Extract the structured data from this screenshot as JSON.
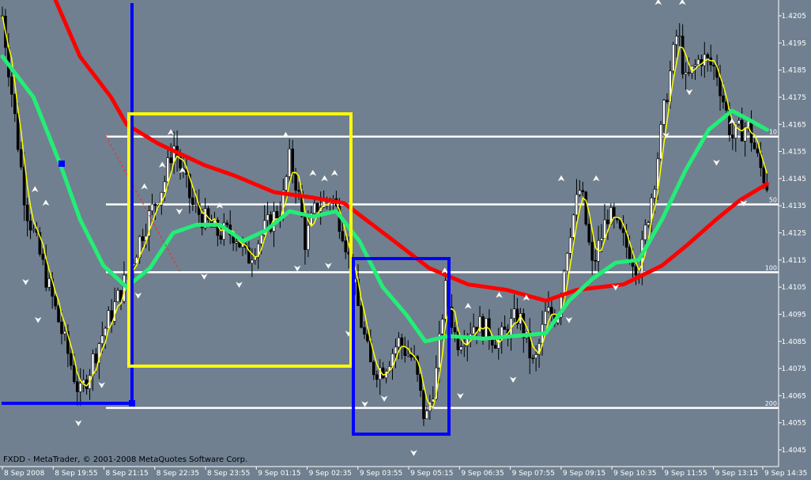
{
  "chart_data": {
    "type": "candlestick",
    "copyright": "FXDD - MetaTrader, © 2001-2008 MetaQuotes Software Corp.",
    "ylim": [
      1.40395,
      1.42125
    ],
    "y_ticks": [
      "1.4205",
      "1.4195",
      "1.4185",
      "1.4175",
      "1.4165",
      "1.4155",
      "1.4145",
      "1.4135",
      "1.4125",
      "1.4115",
      "1.4105",
      "1.4095",
      "1.4085",
      "1.4075",
      "1.4065",
      "1.4055",
      "1.4045"
    ],
    "x_ticks": [
      "8 Sep 2008",
      "8 Sep 19:55",
      "8 Sep 21:15",
      "8 Sep 22:35",
      "8 Sep 23:55",
      "9 Sep 01:15",
      "9 Sep 02:35",
      "9 Sep 03:55",
      "9 Sep 05:15",
      "9 Sep 06:35",
      "9 Sep 07:55",
      "9 Sep 09:15",
      "9 Sep 10:35",
      "9 Sep 11:55",
      "9 Sep 13:15",
      "9 Sep 14:35"
    ],
    "x_tick_fraction": [
      0.0,
      0.0668,
      0.1336,
      0.2004,
      0.2672,
      0.334,
      0.4008,
      0.4676,
      0.5344,
      0.6012,
      0.668,
      0.7348,
      0.8016,
      0.8684,
      0.9352,
      1.0
    ],
    "fib_levels": [
      {
        "label": "10",
        "price": 1.41605
      },
      {
        "label": "50",
        "price": 1.41355
      },
      {
        "label": "100",
        "price": 1.41105
      },
      {
        "label": "200",
        "price": 1.40605
      }
    ],
    "price_path": [
      [
        0.0,
        1.4205
      ],
      [
        0.03,
        1.4135
      ],
      [
        0.06,
        1.4105
      ],
      [
        0.08,
        1.4085
      ],
      [
        0.1,
        1.4065
      ],
      [
        0.125,
        1.4085
      ],
      [
        0.155,
        1.4105
      ],
      [
        0.18,
        1.4125
      ],
      [
        0.21,
        1.4145
      ],
      [
        0.22,
        1.4158
      ],
      [
        0.245,
        1.4135
      ],
      [
        0.275,
        1.4125
      ],
      [
        0.3,
        1.4125
      ],
      [
        0.315,
        1.4115
      ],
      [
        0.335,
        1.4125
      ],
      [
        0.36,
        1.4135
      ],
      [
        0.37,
        1.4152
      ],
      [
        0.38,
        1.4142
      ],
      [
        0.39,
        1.4122
      ],
      [
        0.405,
        1.4135
      ],
      [
        0.425,
        1.4138
      ],
      [
        0.44,
        1.4125
      ],
      [
        0.46,
        1.4095
      ],
      [
        0.475,
        1.4075
      ],
      [
        0.49,
        1.4075
      ],
      [
        0.51,
        1.4085
      ],
      [
        0.53,
        1.4078
      ],
      [
        0.545,
        1.4055
      ],
      [
        0.56,
        1.4075
      ],
      [
        0.57,
        1.4105
      ],
      [
        0.585,
        1.4085
      ],
      [
        0.61,
        1.4092
      ],
      [
        0.64,
        1.4085
      ],
      [
        0.665,
        1.4095
      ],
      [
        0.685,
        1.4075
      ],
      [
        0.7,
        1.4095
      ],
      [
        0.715,
        1.4095
      ],
      [
        0.73,
        1.4125
      ],
      [
        0.745,
        1.4142
      ],
      [
        0.76,
        1.4112
      ],
      [
        0.78,
        1.4132
      ],
      [
        0.8,
        1.4122
      ],
      [
        0.82,
        1.4112
      ],
      [
        0.84,
        1.4145
      ],
      [
        0.855,
        1.4175
      ],
      [
        0.87,
        1.42
      ],
      [
        0.88,
        1.418
      ],
      [
        0.9,
        1.419
      ],
      [
        0.92,
        1.4185
      ],
      [
        0.94,
        1.416
      ],
      [
        0.96,
        1.4165
      ],
      [
        0.975,
        1.415
      ],
      [
        0.985,
        1.4143
      ]
    ],
    "series": [
      {
        "color": "#ff0000",
        "values": [
          [
            0.062,
            1.4215
          ],
          [
            0.1,
            1.419
          ],
          [
            0.14,
            1.4175
          ],
          [
            0.16,
            1.4165
          ],
          [
            0.2,
            1.4158
          ],
          [
            0.26,
            1.415
          ],
          [
            0.3,
            1.4146
          ],
          [
            0.35,
            1.414
          ],
          [
            0.4,
            1.4138
          ],
          [
            0.44,
            1.4136
          ],
          [
            0.5,
            1.4123
          ],
          [
            0.55,
            1.4112
          ],
          [
            0.6,
            1.4106
          ],
          [
            0.65,
            1.4104
          ],
          [
            0.7,
            1.41
          ],
          [
            0.74,
            1.4104
          ],
          [
            0.8,
            1.4106
          ],
          [
            0.85,
            1.4113
          ],
          [
            0.88,
            1.412
          ],
          [
            0.92,
            1.413
          ],
          [
            0.95,
            1.4137
          ],
          [
            0.985,
            1.4143
          ]
        ]
      },
      {
        "color": "#22ee77",
        "values": [
          [
            0.0,
            1.419
          ],
          [
            0.04,
            1.4175
          ],
          [
            0.075,
            1.415
          ],
          [
            0.1,
            1.413
          ],
          [
            0.13,
            1.4113
          ],
          [
            0.16,
            1.4105
          ],
          [
            0.19,
            1.4112
          ],
          [
            0.22,
            1.4125
          ],
          [
            0.25,
            1.4128
          ],
          [
            0.28,
            1.4128
          ],
          [
            0.31,
            1.4122
          ],
          [
            0.34,
            1.4126
          ],
          [
            0.37,
            1.4133
          ],
          [
            0.4,
            1.4131
          ],
          [
            0.43,
            1.4133
          ],
          [
            0.46,
            1.4122
          ],
          [
            0.49,
            1.4105
          ],
          [
            0.52,
            1.4095
          ],
          [
            0.545,
            1.4085
          ],
          [
            0.575,
            1.4087
          ],
          [
            0.62,
            1.4086
          ],
          [
            0.66,
            1.4087
          ],
          [
            0.7,
            1.4088
          ],
          [
            0.73,
            1.41
          ],
          [
            0.76,
            1.4108
          ],
          [
            0.79,
            1.4114
          ],
          [
            0.82,
            1.4115
          ],
          [
            0.85,
            1.413
          ],
          [
            0.88,
            1.4148
          ],
          [
            0.91,
            1.4163
          ],
          [
            0.94,
            1.417
          ],
          [
            0.96,
            1.4167
          ],
          [
            0.985,
            1.4163
          ]
        ]
      }
    ],
    "arrows_up": [
      [
        0.042,
        1.4141
      ],
      [
        0.056,
        1.4136
      ],
      [
        0.183,
        1.4142
      ],
      [
        0.206,
        1.415
      ],
      [
        0.217,
        1.4162
      ],
      [
        0.232,
        1.4148
      ],
      [
        0.28,
        1.4135
      ],
      [
        0.365,
        1.4161
      ],
      [
        0.4,
        1.4147
      ],
      [
        0.415,
        1.4145
      ],
      [
        0.428,
        1.4147
      ],
      [
        0.57,
        1.4111
      ],
      [
        0.6,
        1.4098
      ],
      [
        0.64,
        1.4102
      ],
      [
        0.675,
        1.4101
      ],
      [
        0.72,
        1.4145
      ],
      [
        0.765,
        1.4145
      ],
      [
        0.845,
        1.421
      ],
      [
        0.876,
        1.421
      ],
      [
        0.94,
        1.4166
      ]
    ],
    "arrows_down": [
      [
        0.03,
        1.4107
      ],
      [
        0.046,
        1.4093
      ],
      [
        0.098,
        1.4055
      ],
      [
        0.128,
        1.4069
      ],
      [
        0.175,
        1.4102
      ],
      [
        0.228,
        1.4133
      ],
      [
        0.26,
        1.4109
      ],
      [
        0.305,
        1.4106
      ],
      [
        0.38,
        1.4112
      ],
      [
        0.42,
        1.4113
      ],
      [
        0.446,
        1.4088
      ],
      [
        0.467,
        1.4062
      ],
      [
        0.492,
        1.4064
      ],
      [
        0.53,
        1.4044
      ],
      [
        0.59,
        1.4065
      ],
      [
        0.658,
        1.4071
      ],
      [
        0.73,
        1.4093
      ],
      [
        0.79,
        1.4105
      ],
      [
        0.855,
        1.4161
      ],
      [
        0.885,
        1.4177
      ],
      [
        0.92,
        1.4151
      ],
      [
        0.955,
        1.4136
      ]
    ]
  }
}
